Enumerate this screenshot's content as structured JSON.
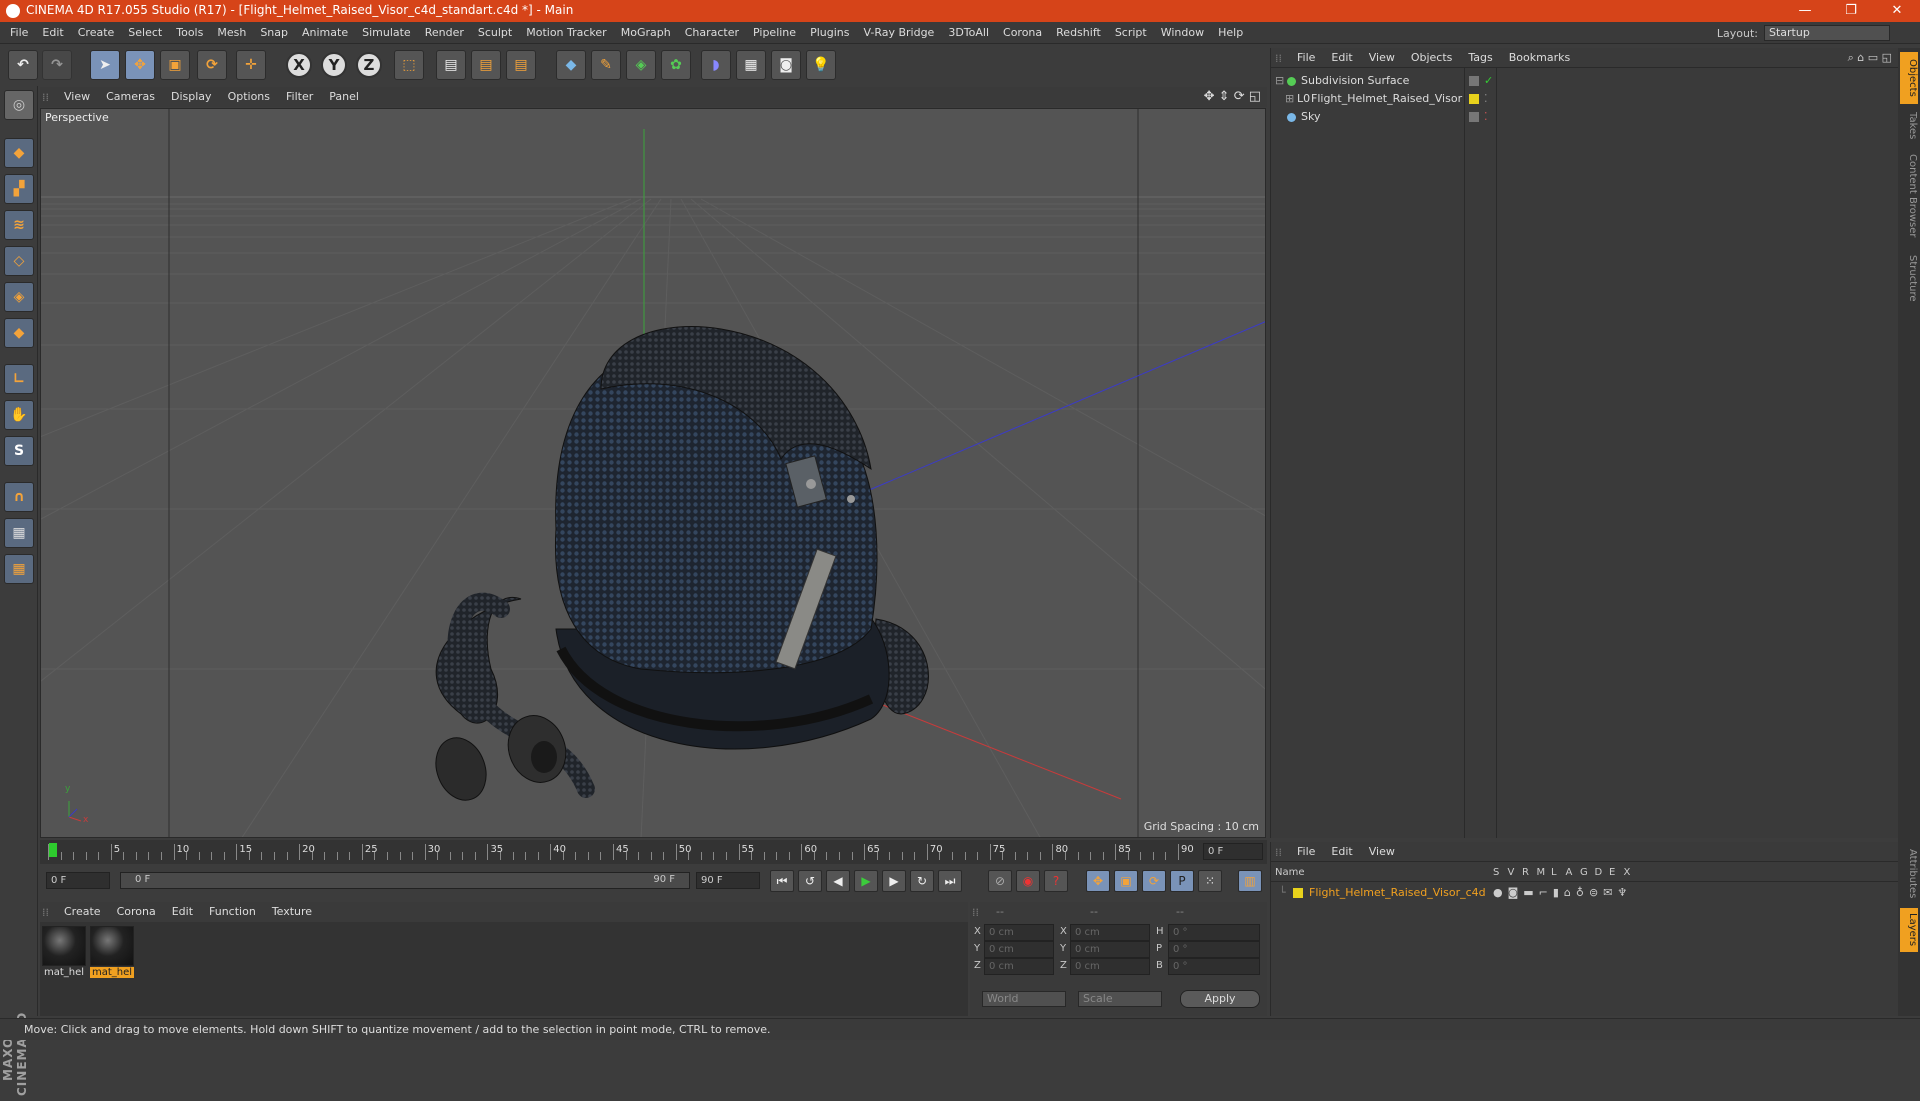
{
  "window": {
    "title": "CINEMA 4D R17.055 Studio (R17) - [Flight_Helmet_Raised_Visor_c4d_standart.c4d *] - Main",
    "minimize": "—",
    "restore": "❐",
    "close": "✕"
  },
  "menubar": {
    "items": [
      "File",
      "Edit",
      "Create",
      "Select",
      "Tools",
      "Mesh",
      "Snap",
      "Animate",
      "Simulate",
      "Render",
      "Sculpt",
      "Motion Tracker",
      "MoGraph",
      "Character",
      "Pipeline",
      "Plugins",
      "V-Ray Bridge",
      "3DToAll",
      "Corona",
      "Redshift",
      "Script",
      "Window",
      "Help"
    ],
    "layout_label": "Layout:",
    "layout_value": "Startup"
  },
  "toolbar": {
    "x_label": "X",
    "y_label": "Y",
    "z_label": "Z"
  },
  "viewport": {
    "menu": [
      "View",
      "Cameras",
      "Display",
      "Options",
      "Filter",
      "Panel"
    ],
    "camera_label": "Perspective",
    "grid_spacing": "Grid Spacing : 10 cm",
    "axis_y": "y",
    "axis_x": "x"
  },
  "timeline": {
    "ticks": [
      "0",
      "5",
      "10",
      "15",
      "20",
      "25",
      "30",
      "35",
      "40",
      "45",
      "50",
      "55",
      "60",
      "65",
      "70",
      "75",
      "80",
      "85",
      "90"
    ],
    "current_frame": "0 F",
    "start_field": "0 F",
    "range_start": "0 F",
    "range_end": "90 F",
    "end_field": "90 F"
  },
  "materials": {
    "menu": [
      "Create",
      "Corona",
      "Edit",
      "Function",
      "Texture"
    ],
    "items": [
      {
        "label": "mat_hel",
        "selected": false
      },
      {
        "label": "mat_hel",
        "selected": true
      }
    ]
  },
  "coords": {
    "header": [
      "--",
      "--",
      "--"
    ],
    "rows": [
      {
        "a": "X",
        "av": "0 cm",
        "b": "X",
        "bv": "0 cm",
        "c": "H",
        "cv": "0 °"
      },
      {
        "a": "Y",
        "av": "0 cm",
        "b": "Y",
        "bv": "0 cm",
        "c": "P",
        "cv": "0 °"
      },
      {
        "a": "Z",
        "av": "0 cm",
        "b": "Z",
        "bv": "0 cm",
        "c": "B",
        "cv": "0 °"
      }
    ],
    "world": "World",
    "scale": "Scale",
    "apply": "Apply"
  },
  "object_manager": {
    "menu": [
      "File",
      "Edit",
      "View",
      "Objects",
      "Tags",
      "Bookmarks"
    ],
    "objects": [
      {
        "name": "Subdivision Surface",
        "color": "#888888"
      },
      {
        "name": "Flight_Helmet_Raised_Visor",
        "color": "#e8d21c"
      },
      {
        "name": "Sky",
        "color": "#888888"
      }
    ]
  },
  "layer_manager": {
    "menu": [
      "File",
      "Edit",
      "View"
    ],
    "columns": [
      "Name",
      "S",
      "V",
      "R",
      "M",
      "L",
      "A",
      "G",
      "D",
      "E",
      "X"
    ],
    "layers": [
      {
        "name": "Flight_Helmet_Raised_Visor_c4d",
        "color": "#e8d21c"
      }
    ]
  },
  "right_tabs": [
    "Objects",
    "Takes",
    "Content Browser",
    "Structure",
    "Attributes",
    "Layers"
  ],
  "status": "Move: Click and drag to move elements. Hold down SHIFT to quantize movement / add to the selection in point mode, CTRL to remove.",
  "branding": "MAXON CINEMA 4D",
  "colors": {
    "title_bar": "#d64419",
    "accent_orange": "#f0a020",
    "active_blue": "#7a93b8"
  }
}
